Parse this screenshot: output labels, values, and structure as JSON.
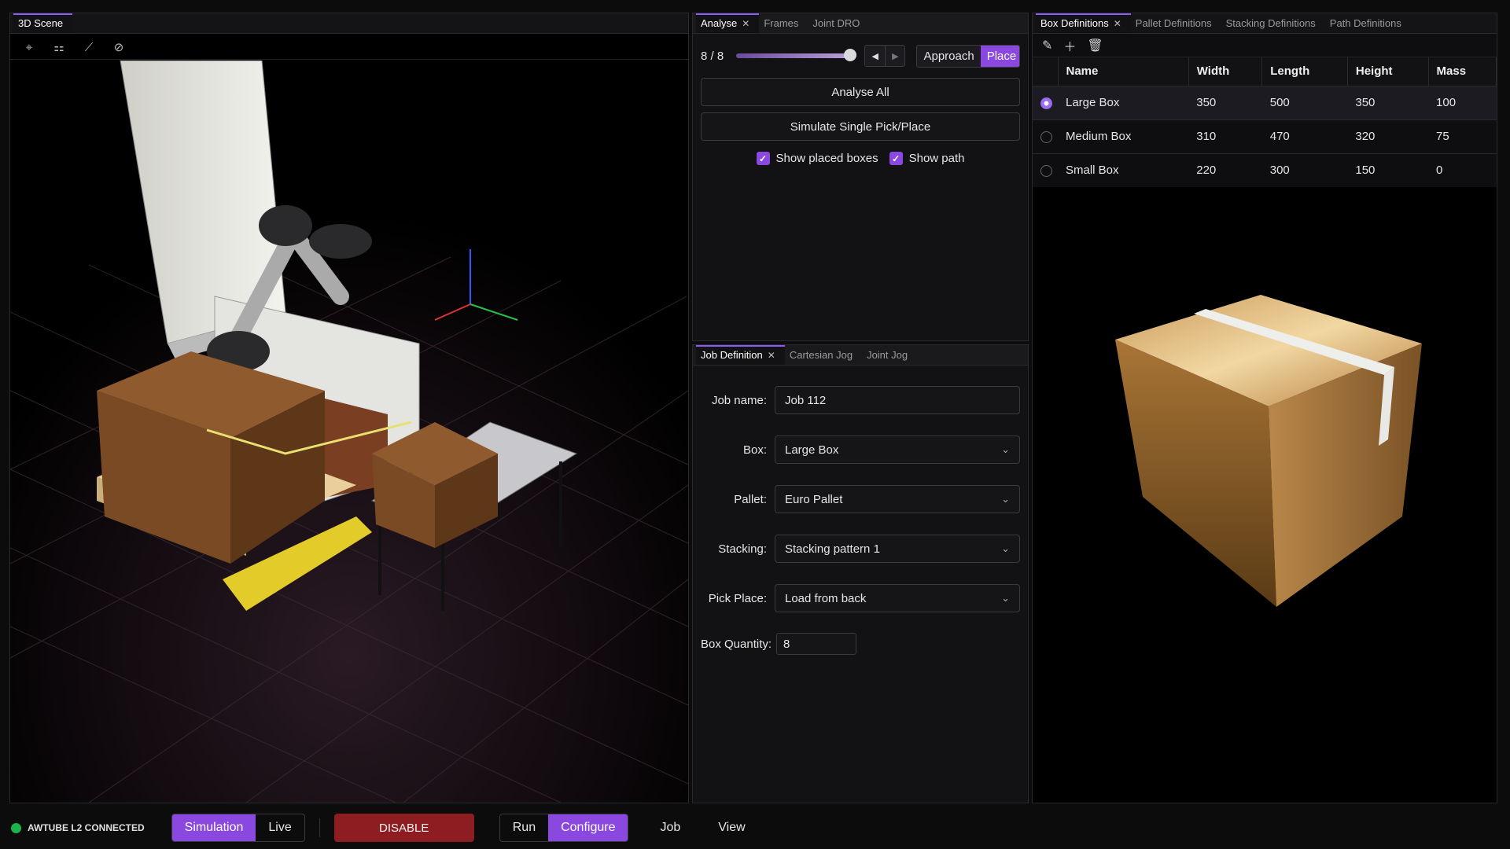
{
  "scene": {
    "tab_label": "3D Scene",
    "toolbar": [
      "pin-icon",
      "tree-icon",
      "graph-icon",
      "circle-icon"
    ]
  },
  "analyse": {
    "tabs": [
      {
        "label": "Analyse",
        "active": true,
        "closable": true
      },
      {
        "label": "Frames",
        "active": false
      },
      {
        "label": "Joint DRO",
        "active": false
      }
    ],
    "counter": "8 / 8",
    "slider_fraction": 1.0,
    "segment": {
      "left": "Approach",
      "right": "Place",
      "selected": "Place"
    },
    "analyse_all": "Analyse All",
    "simulate": "Simulate Single Pick/Place",
    "show_placed": "Show placed boxes",
    "show_path": "Show path"
  },
  "jobdef": {
    "tabs": [
      {
        "label": "Job Definition",
        "active": true,
        "closable": true
      },
      {
        "label": "Cartesian Jog",
        "active": false
      },
      {
        "label": "Joint Jog",
        "active": false
      }
    ],
    "fields": {
      "job_name_label": "Job name:",
      "job_name": "Job 112",
      "box_label": "Box:",
      "box": "Large Box",
      "pallet_label": "Pallet:",
      "pallet": "Euro Pallet",
      "stacking_label": "Stacking:",
      "stacking": "Stacking pattern 1",
      "pickplace_label": "Pick Place:",
      "pickplace": "Load from back",
      "qty_label": "Box Quantity:",
      "qty": "8"
    }
  },
  "boxdefs": {
    "tabs": [
      {
        "label": "Box Definitions",
        "active": true,
        "closable": true
      },
      {
        "label": "Pallet Definitions",
        "active": false
      },
      {
        "label": "Stacking Definitions",
        "active": false
      },
      {
        "label": "Path Definitions",
        "active": false
      }
    ],
    "toolbar": [
      "pencil-icon",
      "plus-icon",
      "trash-icon"
    ],
    "columns": [
      "Name",
      "Width",
      "Length",
      "Height",
      "Mass"
    ],
    "rows": [
      {
        "name": "Large Box",
        "width": "350",
        "length": "500",
        "height": "350",
        "mass": "100",
        "selected": true
      },
      {
        "name": "Medium Box",
        "width": "310",
        "length": "470",
        "height": "320",
        "mass": "75",
        "selected": false
      },
      {
        "name": "Small Box",
        "width": "220",
        "length": "300",
        "height": "150",
        "mass": "0",
        "selected": false
      }
    ]
  },
  "status": {
    "connection": "AWTUBE L2 CONNECTED",
    "mode_sim": "Simulation",
    "mode_live": "Live",
    "disable": "DISABLE",
    "run": "Run",
    "configure": "Configure",
    "job": "Job",
    "view": "View"
  },
  "colors": {
    "accent": "#8a48e0",
    "disable": "#8e1d22",
    "connected": "#1bb34a"
  }
}
